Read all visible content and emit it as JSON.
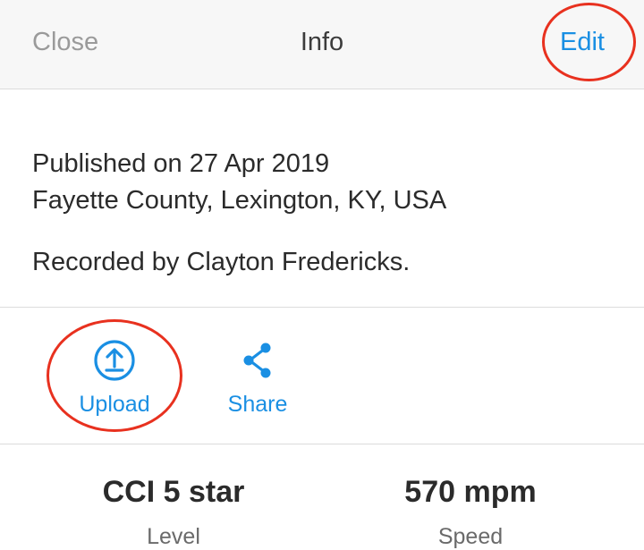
{
  "header": {
    "close_label": "Close",
    "title": "Info",
    "edit_label": "Edit"
  },
  "info": {
    "published": "Published on 27 Apr 2019",
    "location": "Fayette County, Lexington, KY, USA",
    "recorded_by": "Recorded by Clayton Fredericks."
  },
  "actions": {
    "upload": {
      "label": "Upload",
      "icon": "upload-circle-icon"
    },
    "share": {
      "label": "Share",
      "icon": "share-icon"
    }
  },
  "stats": {
    "level": {
      "value": "CCI 5 star",
      "caption": "Level"
    },
    "speed": {
      "value": "570 mpm",
      "caption": "Speed"
    }
  },
  "colors": {
    "accent": "#1a8fe3",
    "annotation_ring": "#e8311f",
    "header_bg": "#f7f7f7"
  }
}
